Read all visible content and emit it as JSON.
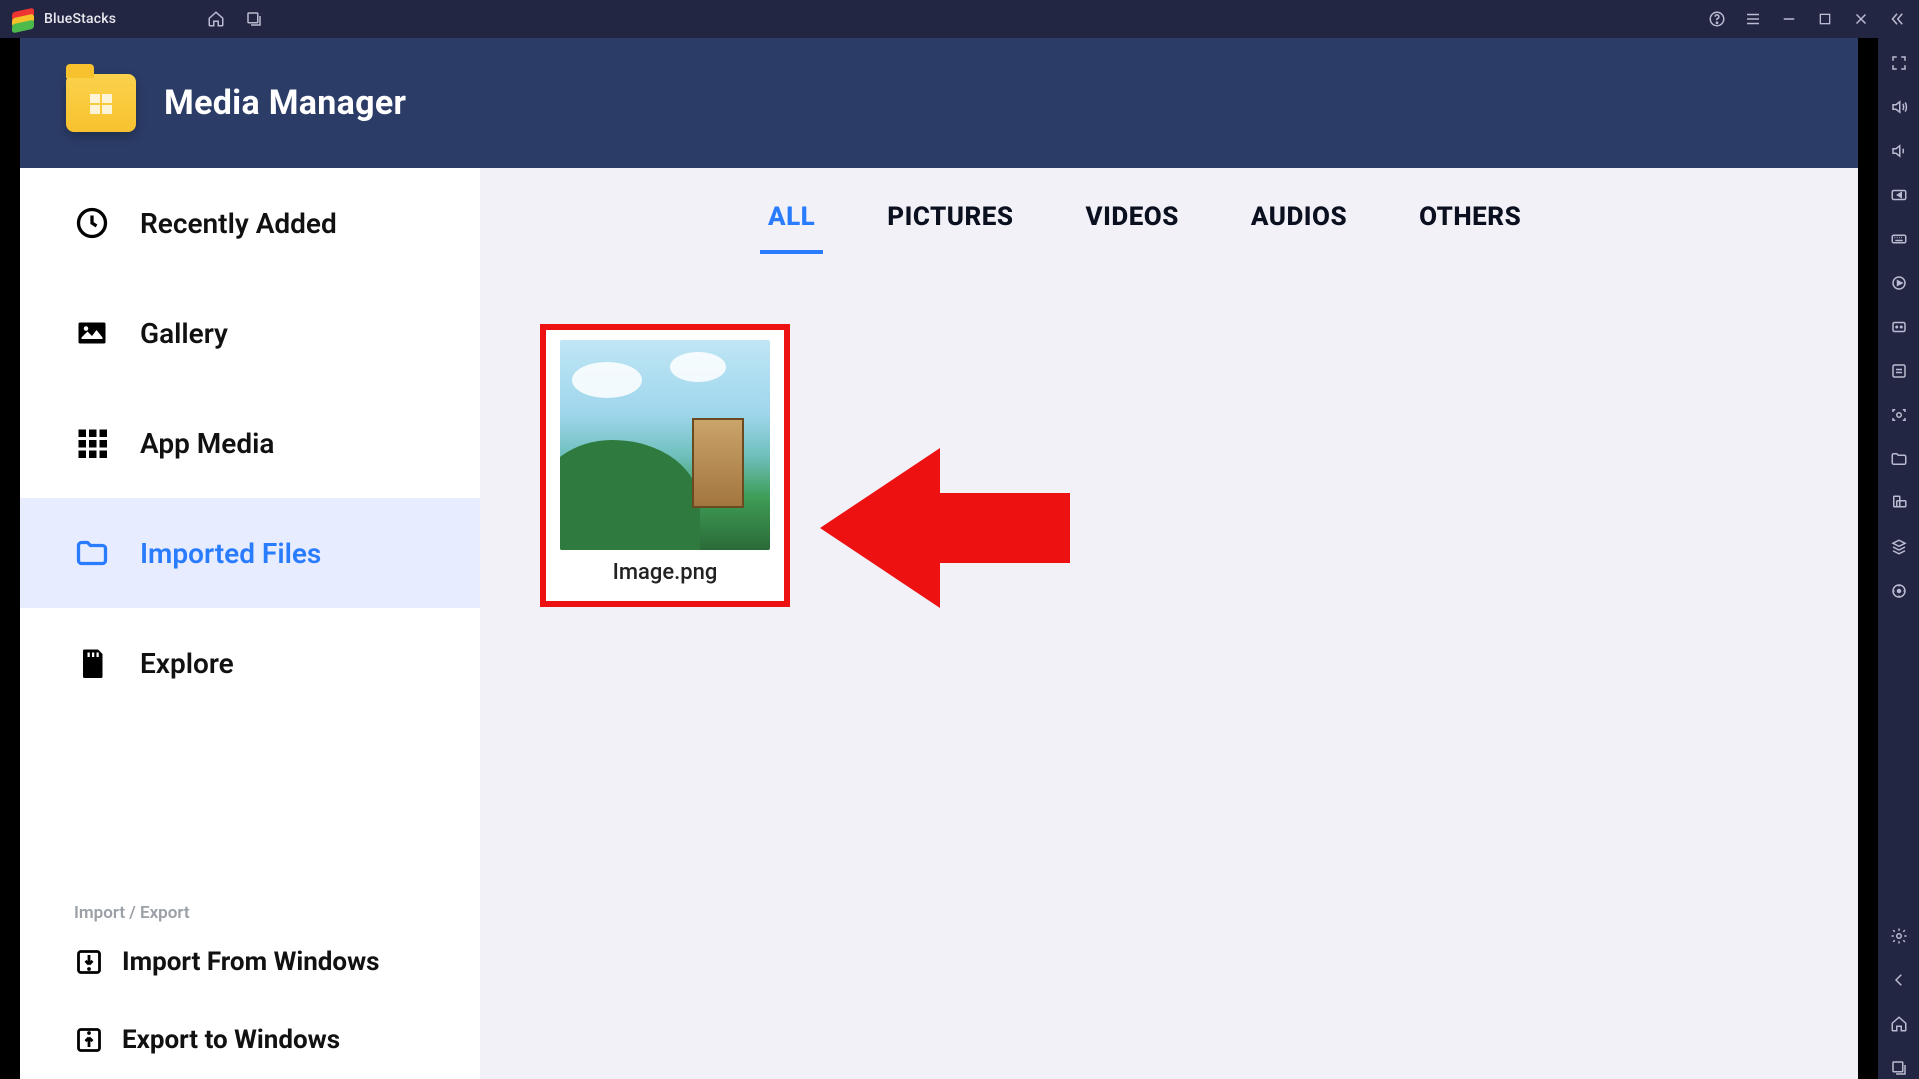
{
  "titlebar": {
    "app_name": "BlueStacks"
  },
  "header": {
    "title": "Media Manager"
  },
  "sidebar": {
    "items": [
      {
        "label": "Recently Added",
        "icon": "clock-icon"
      },
      {
        "label": "Gallery",
        "icon": "picture-icon"
      },
      {
        "label": "App Media",
        "icon": "grid-icon"
      },
      {
        "label": "Imported Files",
        "icon": "folder-icon",
        "selected": true
      },
      {
        "label": "Explore",
        "icon": "sd-card-icon"
      }
    ],
    "section_label": "Import / Export",
    "import_label": "Import From Windows",
    "export_label": "Export to Windows"
  },
  "tabs": [
    {
      "label": "ALL",
      "active": true
    },
    {
      "label": "PICTURES"
    },
    {
      "label": "VIDEOS"
    },
    {
      "label": "AUDIOS"
    },
    {
      "label": "OTHERS"
    }
  ],
  "files": [
    {
      "name": "Image.png"
    }
  ]
}
